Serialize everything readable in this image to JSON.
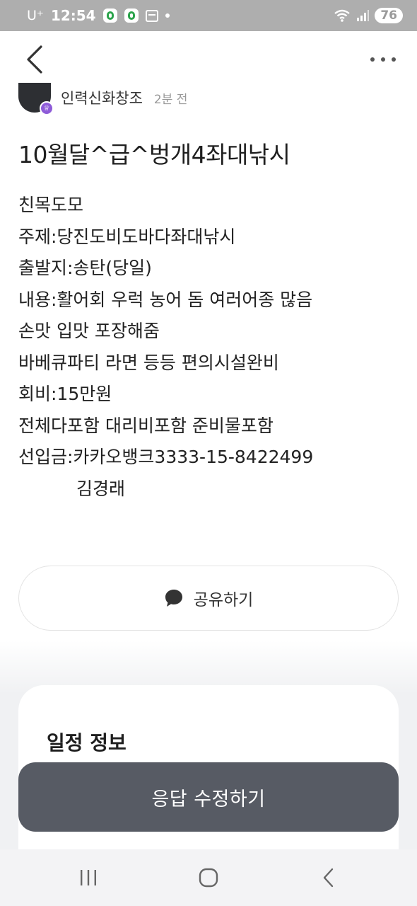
{
  "status_bar": {
    "carrier": "U⁺",
    "time": "12:54",
    "battery": "76"
  },
  "post": {
    "author": "인력신화창조",
    "time_ago": "2분 전",
    "title": "10월달^급^벙개4좌대낚시",
    "body_lines": [
      "친목도모",
      "주제:당진도비도바다좌대낚시",
      "출발지:송탄(당일)",
      "내용:활어회 우럭 농어 돔 여러어종 많음",
      "손맛 입맛 포장해줌",
      "바베큐파티 라면 등등 편의시설완비",
      "회비:15만원",
      "전체다포함 대리비포함 준비물포함",
      "선입금:카카오뱅크3333-15-8422499",
      "김경래"
    ]
  },
  "share_button": {
    "label": "공유하기"
  },
  "schedule": {
    "title": "일정 정보"
  },
  "respond_button": {
    "label": "응답 수정하기"
  },
  "icons": {
    "back": "chevron-left-icon",
    "more": "more-horizontal-icon",
    "share": "speech-bubble-icon",
    "crown": "crown-icon"
  },
  "colors": {
    "respond_button": "#575b64",
    "crown_badge": "#8e5bd8",
    "status_bar": "#aeaeae"
  }
}
